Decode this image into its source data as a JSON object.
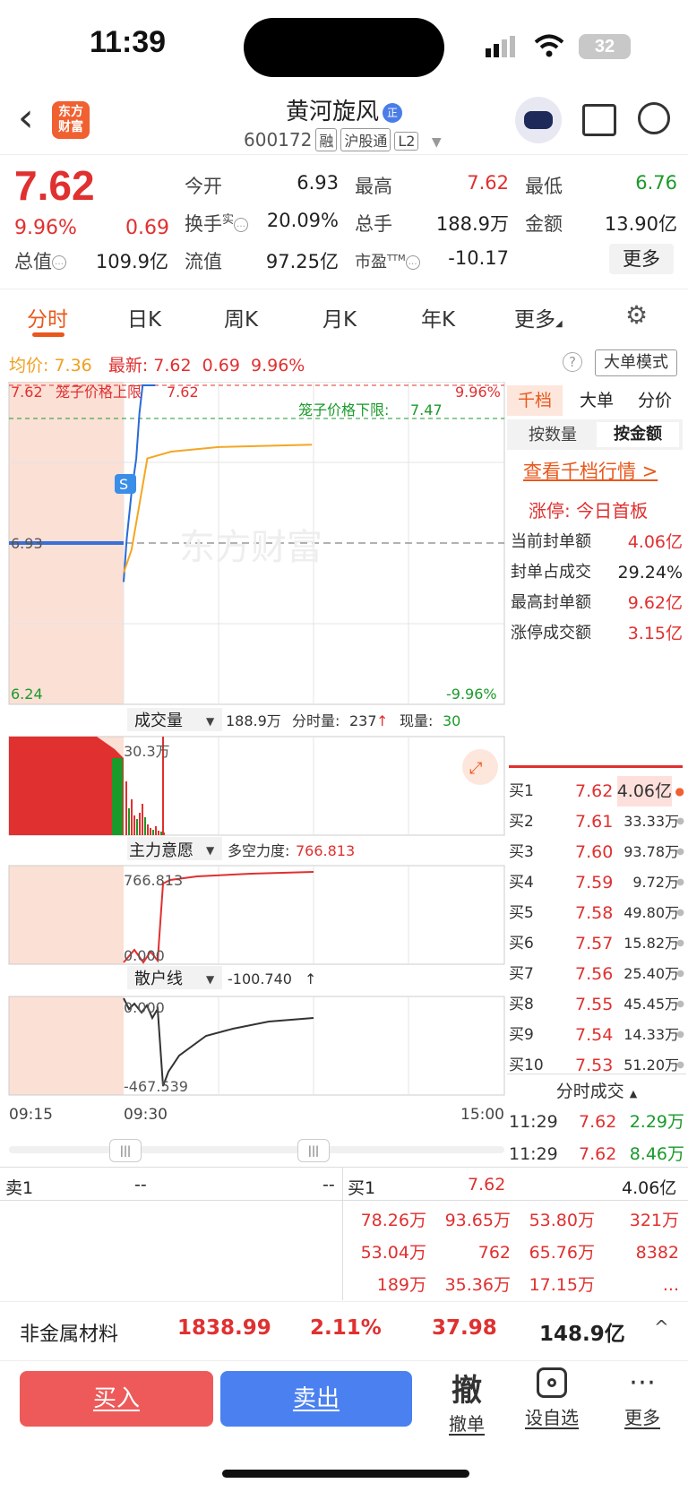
{
  "status": {
    "time": "11:39",
    "battery": "32"
  },
  "header": {
    "logo": [
      "东方",
      "财富"
    ],
    "name": "黄河旋风",
    "name_badge": "正",
    "code": "600172",
    "tags": [
      "融",
      "沪股通",
      "L2"
    ]
  },
  "quote": {
    "price": "7.62",
    "pct": "9.96%",
    "change": "0.69",
    "open_label": "今开",
    "open": "6.93",
    "high_label": "最高",
    "high": "7.62",
    "low_label": "最低",
    "low": "6.76",
    "turnover_label": "换手",
    "turnover_sup": "实",
    "turnover": "20.09%",
    "volume_label": "总手",
    "volume": "188.9万",
    "amount_label": "金额",
    "amount": "13.90亿",
    "mktcap_label": "总值",
    "mktcap": "109.9亿",
    "float_label": "流值",
    "float": "97.25亿",
    "pe_label": "市盈",
    "pe_sup": "TTM",
    "pe": "-10.17",
    "more": "更多"
  },
  "tabs": [
    "分时",
    "日K",
    "周K",
    "月K",
    "年K",
    "更多"
  ],
  "avg_row": {
    "avg_label": "均价:",
    "avg": "7.36",
    "latest_label": "最新:",
    "latest": "7.62",
    "chg": "0.69",
    "pct": "9.96%",
    "big_mode": "大单模式"
  },
  "chart": {
    "top_price": "7.62",
    "top_pct": "9.96%",
    "limit_up_label": "笼子价格上限",
    "limit_up_val": "7.62",
    "limit_down_label": "笼子价格下限:",
    "limit_down_val": "7.47",
    "mid_price": "6.93",
    "bottom_price": "6.24",
    "bottom_pct": "-9.96%",
    "watermark": "东方财富",
    "volume_label": "成交量",
    "volume_total": "188.9万",
    "fen_label": "分时量:",
    "fen_val": "237",
    "xian_label": "现量:",
    "xian_val": "30",
    "volume_max": "30.3万",
    "zhuli_label": "主力意愿",
    "duokong_label": "多空力度:",
    "duokong_val": "766.813",
    "zhuli_max": "766.813",
    "zhuli_min": "0.000",
    "sanhu_label": "散户线",
    "sanhu_val": "-100.740",
    "sanhu_max": "0.000",
    "sanhu_min": "-467.539",
    "t_start": "09:15",
    "t_open": "09:30",
    "t_end": "15:00"
  },
  "chart_data": {
    "type": "line",
    "title": "",
    "xlabel": "",
    "ylabel": "",
    "x_ticks": [
      "09:15",
      "09:30",
      "15:00"
    ],
    "y_ticks_left": [
      "7.62",
      "6.93",
      "6.24"
    ],
    "y_ticks_right": [
      "9.96%",
      "-9.96%"
    ],
    "ylim": [
      6.24,
      7.62
    ],
    "series": [
      {
        "name": "",
        "x": [
          "09:30",
          "09:32",
          "09:35",
          "09:38",
          "09:40",
          "09:42",
          "09:45",
          "09:50"
        ],
        "values": [
          6.76,
          6.95,
          7.15,
          7.3,
          7.5,
          7.62,
          7.62,
          7.62
        ]
      },
      {
        "name": "均价",
        "x": [
          "09:30",
          "09:35",
          "09:40",
          "09:45",
          "10:00",
          "10:30",
          "11:29"
        ],
        "values": [
          6.8,
          6.9,
          7.1,
          7.3,
          7.33,
          7.35,
          7.36
        ]
      }
    ]
  },
  "side": {
    "tabs": [
      "千档",
      "大单",
      "分价"
    ],
    "sub_tabs": [
      "按数量",
      "按金额"
    ],
    "link": "查看千档行情 >",
    "zt_label": "涨停:",
    "zt_val": "今日首板",
    "rows": [
      {
        "label": "当前封单额",
        "val": "4.06亿"
      },
      {
        "label": "封单占成交",
        "val": "29.24%"
      },
      {
        "label": "最高封单额",
        "val": "9.62亿"
      },
      {
        "label": "涨停成交额",
        "val": "3.15亿"
      }
    ],
    "bids": [
      {
        "label": "买1",
        "price": "7.62",
        "vol": "4.06亿"
      },
      {
        "label": "买2",
        "price": "7.61",
        "vol": "33.33万"
      },
      {
        "label": "买3",
        "price": "7.60",
        "vol": "93.78万"
      },
      {
        "label": "买4",
        "price": "7.59",
        "vol": "9.72万"
      },
      {
        "label": "买5",
        "price": "7.58",
        "vol": "49.80万"
      },
      {
        "label": "买6",
        "price": "7.57",
        "vol": "15.82万"
      },
      {
        "label": "买7",
        "price": "7.56",
        "vol": "25.40万"
      },
      {
        "label": "买8",
        "price": "7.55",
        "vol": "45.45万"
      },
      {
        "label": "买9",
        "price": "7.54",
        "vol": "14.33万"
      },
      {
        "label": "买10",
        "price": "7.53",
        "vol": "51.20万"
      }
    ],
    "fen_title": "分时成交",
    "trades": [
      {
        "time": "11:29",
        "price": "7.62",
        "vol": "2.29万"
      },
      {
        "time": "11:29",
        "price": "7.62",
        "vol": "8.46万"
      }
    ]
  },
  "book": {
    "sell_label": "卖1",
    "sell_price": "--",
    "sell_vol": "--",
    "buy_label": "买1",
    "buy_price": "7.62",
    "buy_vol": "4.06亿",
    "queue": [
      [
        "78.26万",
        "93.65万",
        "53.80万",
        "321万"
      ],
      [
        "53.04万",
        "762",
        "65.76万",
        "8382"
      ],
      [
        "189万",
        "35.36万",
        "17.15万",
        "..."
      ]
    ]
  },
  "industry": {
    "name": "非金属材料",
    "index": "1838.99",
    "pct": "2.11%",
    "chg": "37.98",
    "amount": "148.9亿"
  },
  "actions": {
    "buy": "买入",
    "sell": "卖出",
    "cancel_big": "撤",
    "cancel": "撤单",
    "watch": "设自选",
    "more": "更多"
  }
}
